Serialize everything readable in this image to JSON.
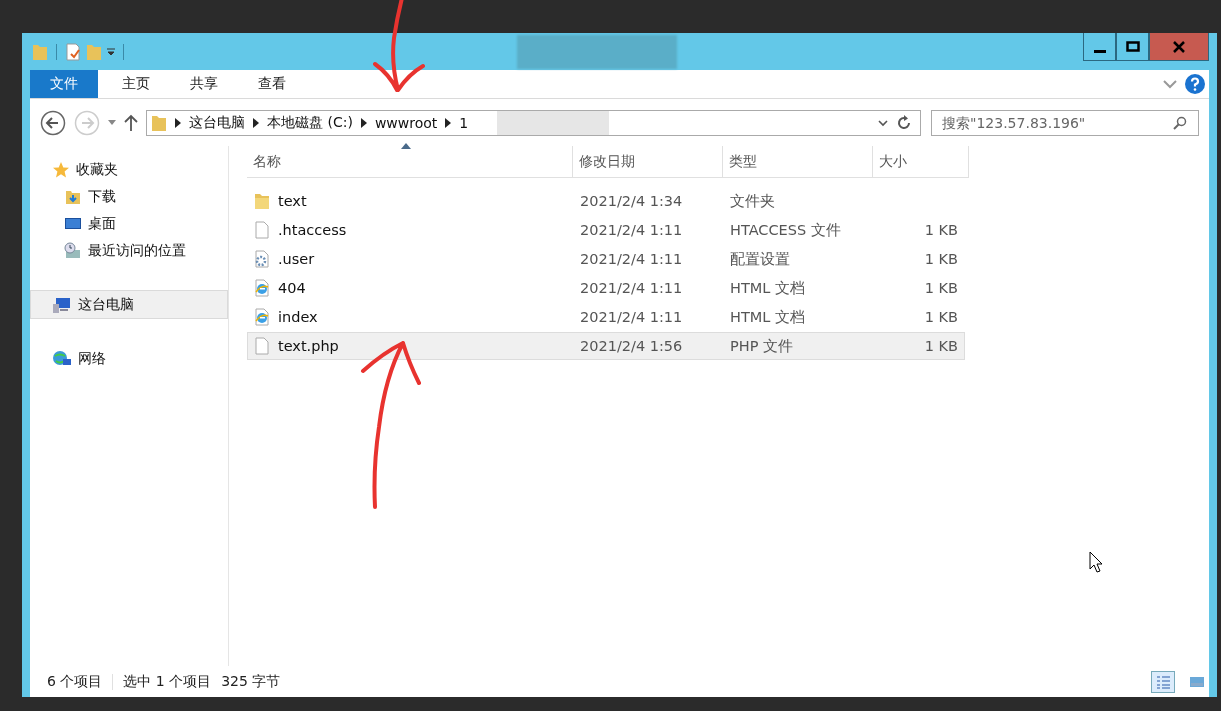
{
  "ribbon": {
    "tabs": [
      {
        "label": "文件",
        "selected": true
      },
      {
        "label": "主页",
        "selected": false
      },
      {
        "label": "共享",
        "selected": false
      },
      {
        "label": "查看",
        "selected": false
      }
    ]
  },
  "address": {
    "crumbs": [
      "这台电脑",
      "本地磁盘 (C:)",
      "wwwroot",
      "1"
    ]
  },
  "search": {
    "placeholder": "搜索\"123.57.83.196\""
  },
  "sidebar": {
    "items": [
      {
        "label": "收藏夹",
        "kind": "star",
        "selected": false,
        "children": [
          {
            "label": "下载",
            "kind": "download",
            "selected": false
          },
          {
            "label": "桌面",
            "kind": "desktop",
            "selected": false
          },
          {
            "label": "最近访问的位置",
            "kind": "recent",
            "selected": false
          }
        ]
      },
      {
        "label": "这台电脑",
        "kind": "computer",
        "selected": true
      },
      {
        "label": "网络",
        "kind": "network",
        "selected": false
      }
    ]
  },
  "table": {
    "columns": [
      "名称",
      "修改日期",
      "类型",
      "大小"
    ],
    "rows": [
      {
        "kind": "folder",
        "name": "text",
        "date": "2021/2/4 1:34",
        "type": "文件夹",
        "size": "",
        "selected": false
      },
      {
        "kind": "file",
        "name": ".htaccess",
        "date": "2021/2/4 1:11",
        "type": "HTACCESS 文件",
        "size": "1 KB",
        "selected": false
      },
      {
        "kind": "settings",
        "name": ".user",
        "date": "2021/2/4 1:11",
        "type": "配置设置",
        "size": "1 KB",
        "selected": false
      },
      {
        "kind": "web",
        "name": "404",
        "date": "2021/2/4 1:11",
        "type": "HTML 文档",
        "size": "1 KB",
        "selected": false
      },
      {
        "kind": "web",
        "name": "index",
        "date": "2021/2/4 1:11",
        "type": "HTML 文档",
        "size": "1 KB",
        "selected": false
      },
      {
        "kind": "file",
        "name": "text.php",
        "date": "2021/2/4 1:56",
        "type": "PHP 文件",
        "size": "1 KB",
        "selected": true
      }
    ]
  },
  "status_bar": {
    "count": "6 个项目",
    "selection": "选中 1 个项目",
    "size": "325 字节"
  }
}
